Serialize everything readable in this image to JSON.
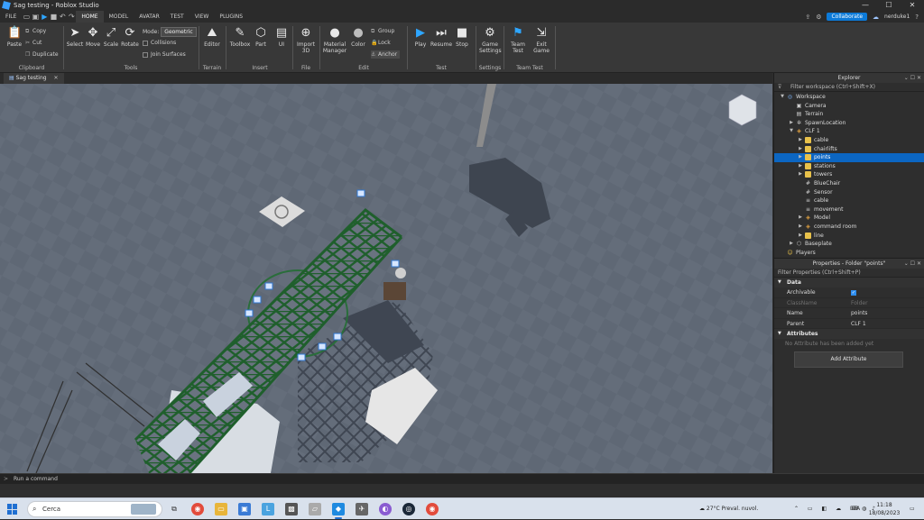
{
  "window": {
    "title": "Sag testing - Roblox Studio",
    "minimize": "—",
    "maximize": "☐",
    "close": "✕"
  },
  "menu": {
    "file": "FILE",
    "tabs": [
      "HOME",
      "MODEL",
      "AVATAR",
      "TEST",
      "VIEW",
      "PLUGINS"
    ],
    "collaborate": "Collaborate",
    "user": "nerduke1"
  },
  "ribbon": {
    "clipboard": {
      "paste": "Paste",
      "copy": "Copy",
      "cut": "Cut",
      "duplicate": "Duplicate",
      "label": "Clipboard"
    },
    "tools": {
      "select": "Select",
      "move": "Move",
      "scale": "Scale",
      "rotate": "Rotate",
      "mode_label": "Mode:",
      "mode_value": "Geometric",
      "collisions": "Collisions",
      "join_surfaces": "Join Surfaces",
      "label": "Tools"
    },
    "terrain": {
      "editor": "Editor",
      "label": "Terrain"
    },
    "insert": {
      "toolbox": "Toolbox",
      "part": "Part",
      "ui": "UI",
      "label": "Insert"
    },
    "file": {
      "import3d": "Import 3D",
      "label": "File"
    },
    "edit": {
      "material": "Material Manager",
      "color": "Color",
      "group": "Group",
      "lock": "Lock",
      "anchor": "Anchor",
      "label": "Edit"
    },
    "test": {
      "play": "Play",
      "resume": "Resume",
      "stop": "Stop",
      "label": "Test"
    },
    "settings": {
      "game_settings": "Game Settings",
      "label": "Settings"
    },
    "team_test": {
      "team_test": "Team Test",
      "exit_game": "Exit Game",
      "label": "Team Test"
    }
  },
  "doc_tab": {
    "label": "Sag testing",
    "close": "✕"
  },
  "explorer": {
    "title": "Explorer",
    "filter_placeholder": "Filter workspace (Ctrl+Shift+X)",
    "items": [
      {
        "label": "Workspace",
        "depth": 0,
        "arrow": "▼",
        "icon": "workspace-icon"
      },
      {
        "label": "Camera",
        "depth": 1,
        "arrow": "",
        "icon": "camera-icon"
      },
      {
        "label": "Terrain",
        "depth": 1,
        "arrow": "",
        "icon": "terrain-icon"
      },
      {
        "label": "SpawnLocation",
        "depth": 1,
        "arrow": "▶",
        "icon": "spawn-icon"
      },
      {
        "label": "CLF 1",
        "depth": 1,
        "arrow": "▼",
        "icon": "model-icon"
      },
      {
        "label": "cable",
        "depth": 2,
        "arrow": "▶",
        "icon": "folder-icon"
      },
      {
        "label": "chairlifts",
        "depth": 2,
        "arrow": "▶",
        "icon": "folder-icon"
      },
      {
        "label": "points",
        "depth": 2,
        "arrow": "▶",
        "icon": "folder-icon",
        "selected": true
      },
      {
        "label": "stations",
        "depth": 2,
        "arrow": "▶",
        "icon": "folder-icon"
      },
      {
        "label": "towers",
        "depth": 2,
        "arrow": "▶",
        "icon": "folder-icon"
      },
      {
        "label": "BlueChair",
        "depth": 2,
        "arrow": "",
        "icon": "value-icon"
      },
      {
        "label": "Sensor",
        "depth": 2,
        "arrow": "",
        "icon": "value-icon"
      },
      {
        "label": "cable",
        "depth": 2,
        "arrow": "",
        "icon": "script-icon"
      },
      {
        "label": "movement",
        "depth": 2,
        "arrow": "",
        "icon": "script-icon"
      },
      {
        "label": "Model",
        "depth": 2,
        "arrow": "▶",
        "icon": "model-icon"
      },
      {
        "label": "command room",
        "depth": 2,
        "arrow": "▶",
        "icon": "model-icon"
      },
      {
        "label": "line",
        "depth": 2,
        "arrow": "▶",
        "icon": "folder-icon"
      },
      {
        "label": "Baseplate",
        "depth": 1,
        "arrow": "▶",
        "icon": "part-icon"
      },
      {
        "label": "Players",
        "depth": 0,
        "arrow": "",
        "icon": "players-icon"
      }
    ]
  },
  "properties": {
    "title": "Properties - Folder \"points\"",
    "filter_placeholder": "Filter Properties (Ctrl+Shift+P)",
    "data_section": "Data",
    "rows": [
      {
        "key": "Archivable",
        "value": "✓",
        "type": "checkbox"
      },
      {
        "key": "ClassName",
        "value": "Folder",
        "disabled": true
      },
      {
        "key": "Name",
        "value": "points"
      },
      {
        "key": "Parent",
        "value": "CLF 1"
      }
    ],
    "attributes_section": "Attributes",
    "no_attr": "No Attribute has been added yet",
    "add_attribute": "Add Attribute"
  },
  "command_bar": {
    "placeholder": "Run a command"
  },
  "taskbar": {
    "search": "Cerca",
    "weather": "27°C  Preval. nuvol.",
    "lang": "ITA",
    "time": "11:18",
    "date": "18/08/2023"
  },
  "colors": {
    "accent": "#0c7ad8",
    "selection": "#0c66c2",
    "truss": "#1f5f2c",
    "baseplate": "#5d6673"
  }
}
